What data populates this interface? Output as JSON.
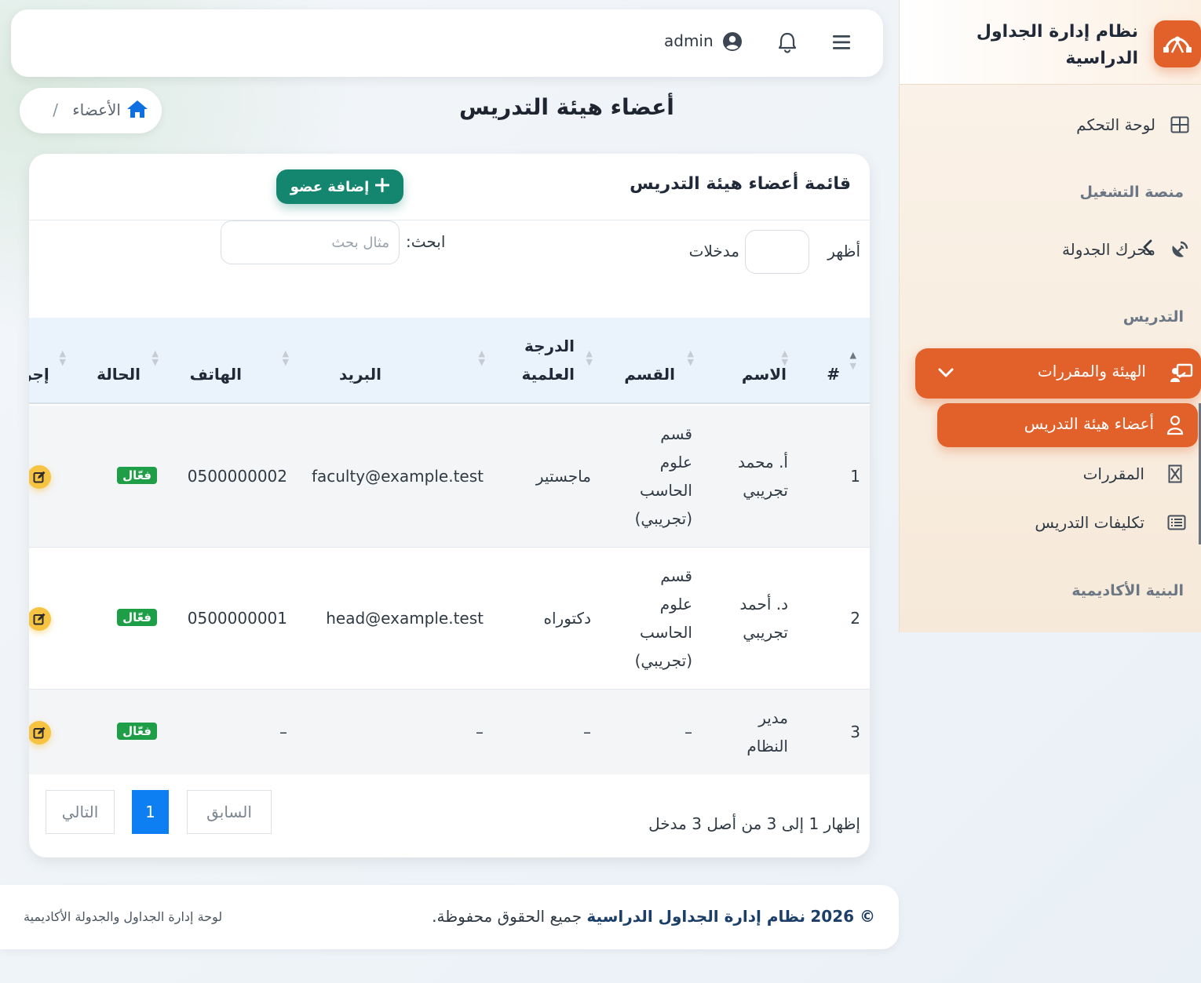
{
  "brand": {
    "title": "نظام إدارة الجداول الدراسية"
  },
  "topbar": {
    "user_name": "admin"
  },
  "sidebar": {
    "dashboard": "لوحة التحكم",
    "section_platform": "منصة التشغيل",
    "engine": "محرك الجدولة",
    "section_teaching": "التدريس",
    "faculty_courses": "الهيئة والمقررات",
    "faculty_members": "أعضاء هيئة التدريس",
    "courses": "المقررات",
    "assignments": "تكليفات التدريس",
    "section_academic": "البنية الأكاديمية"
  },
  "page": {
    "title": "أعضاء هيئة التدريس",
    "breadcrumb_label": "الأعضاء",
    "breadcrumb_sep": "/"
  },
  "card": {
    "title": "قائمة أعضاء هيئة التدريس",
    "add_button": "إضافة عضو",
    "show_label": "أظهر",
    "entries_label": "مدخلات",
    "search_label": "ابحث:",
    "search_placeholder": "مثال بحث",
    "info": "إظهار 1 إلى 3 من أصل 3 مدخل",
    "prev": "السابق",
    "current_page": "1",
    "next": "التالي"
  },
  "table": {
    "headers": {
      "num": "#",
      "name": "الاسم",
      "dept": "القسم",
      "degree_1": "الدرجة",
      "degree_2": "العلمية",
      "email": "البريد",
      "phone": "الهاتف",
      "status": "الحالة",
      "actions": "إجراءات"
    },
    "rows": [
      {
        "num": "1",
        "name_1": "أ. محمد",
        "name_2": "تجريبي",
        "dept_1": "قسم",
        "dept_2": "علوم",
        "dept_3": "الحاسب",
        "dept_4": "(تجريبي)",
        "degree": "ماجستير",
        "email": "faculty@example.test",
        "phone": "0500000002",
        "status": "فعّال"
      },
      {
        "num": "2",
        "name_1": "د. أحمد",
        "name_2": "تجريبي",
        "dept_1": "قسم",
        "dept_2": "علوم",
        "dept_3": "الحاسب",
        "dept_4": "(تجريبي)",
        "degree": "دكتوراه",
        "email": "head@example.test",
        "phone": "0500000001",
        "status": "فعّال"
      },
      {
        "num": "3",
        "name_1": "مدير",
        "name_2": "النظام",
        "dept": "–",
        "degree": "–",
        "email": "–",
        "phone": "–",
        "status": "فعّال"
      }
    ]
  },
  "footer": {
    "copy_prefix": "© 2026",
    "copy_brand": "نظام إدارة الجداول الدراسية",
    "copy_suffix": "جميع الحقوق محفوظة.",
    "right_text": "لوحة إدارة الجداول والجدولة الأكاديمية"
  },
  "colors": {
    "accent": "#e2602a",
    "primary": "#14866f",
    "page_active": "#0d7ff2",
    "badge": "#1e9e47",
    "edit": "#f6c343"
  }
}
